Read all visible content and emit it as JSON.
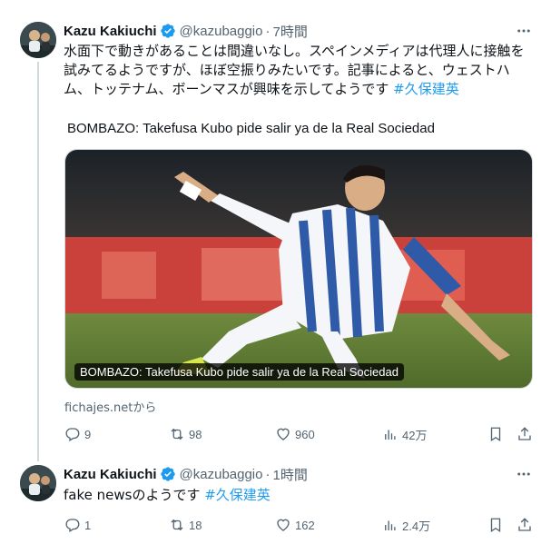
{
  "tweet1": {
    "author": {
      "name": "Kazu Kakiuchi",
      "handle": "@kazubaggio",
      "time": "7時間",
      "dot": "·"
    },
    "text_line1": "水面下で動きがあることは間違いなし。スペインメディアは代理人に接触を",
    "text_line2": "試みてるようですが、ほぼ空振りみたいです。記事によると、ウェストハ",
    "text_line3": "ム、トッテナム、ボーンマスが興味を示してようです ",
    "hashtag": "#久保建英",
    "card_title": "BOMBAZO: Takefusa Kubo pide salir ya de la Real Sociedad",
    "media_caption": "BOMBAZO: Takefusa Kubo pide salir ya de la Real Sociedad",
    "source": "fichajes.netから",
    "stats": {
      "replies": "9",
      "retweets": "98",
      "likes": "960",
      "views": "42万"
    }
  },
  "tweet2": {
    "author": {
      "name": "Kazu Kakiuchi",
      "handle": "@kazubaggio",
      "time": "1時間",
      "dot": "·"
    },
    "text": "fake newsのようです ",
    "hashtag": "#久保建英",
    "stats": {
      "replies": "1",
      "retweets": "18",
      "likes": "162",
      "views": "2.4万"
    }
  },
  "colors": {
    "accent": "#1d9bf0",
    "muted": "#536471",
    "text": "#0f1419"
  },
  "icons": [
    "verified-badge-icon",
    "more-icon",
    "reply-icon",
    "retweet-icon",
    "like-icon",
    "views-icon",
    "bookmark-icon",
    "share-icon"
  ]
}
